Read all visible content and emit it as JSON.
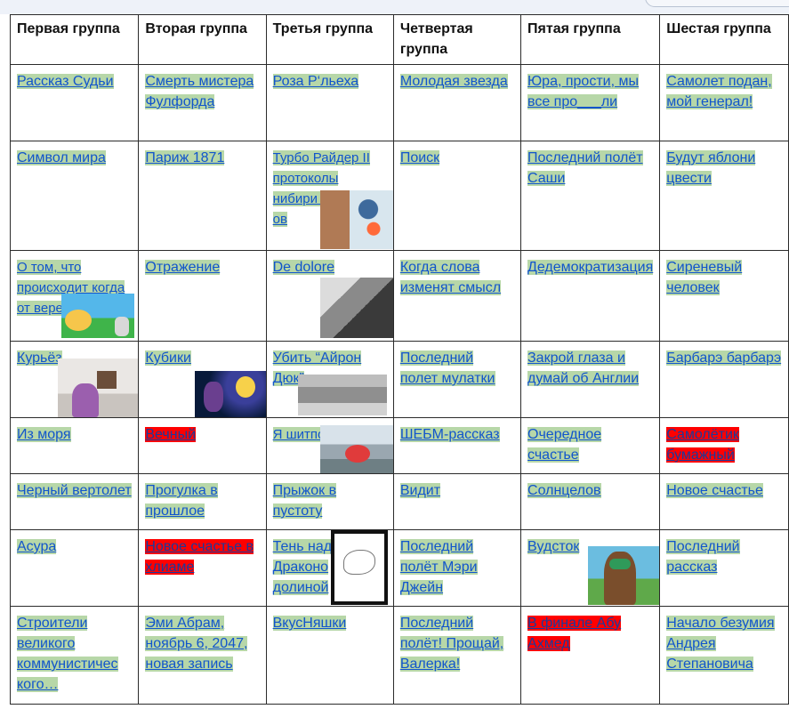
{
  "headers": [
    "Первая группа",
    "Вторая группа",
    "Третья группа",
    "Четвертая группа",
    "Пятая группа",
    "Шестая группа"
  ],
  "rows": [
    [
      "Рассказ Судьи",
      "Смерть мистера Фулфорда",
      "Роза Р‘льеха",
      "Молодая звезда",
      "Юра, прости, мы все про___ли",
      "Самолет подан, мой генерал!"
    ],
    [
      "Символ мира",
      "Париж 1871",
      "Турбо Райдер II протоколы нибири гаввахо ов",
      "Поиск",
      "Последний полёт Саши",
      "Будут яблони цвести"
    ],
    [
      "О том, что происходит когда от вереск",
      "Отражение",
      "De dolore",
      "Когда слова изменят смысл",
      "Дедемократизация",
      "Сиреневый человек"
    ],
    [
      "Курьёз",
      "Кубики",
      "Убить “Айрон Дюк”",
      "Последний полет мулатки",
      "Закрой глаза и думай об Англии",
      "Барбарэ барбарэ"
    ],
    [
      "Из моря",
      "Вечный",
      "Я шитпо сосаче",
      "ШЕБМ-рассказ",
      "Очередное счастье",
      "Самолётик бумажный"
    ],
    [
      "Черный вертолет",
      "Прогулка в прошлое",
      "Прыжок в пустоту",
      "Видит",
      "Солнцелов",
      "Новое счастье"
    ],
    [
      "Асура",
      "Новое счастье в хлиаме",
      "Тень над Драконо долиной",
      "Последний полёт Мэри Джейн",
      "Вудсток",
      "Последний рассказ"
    ],
    [
      "Строители великого коммунистичес кого…",
      "Эми Абрам, ноябрь 6, 2047, новая запись",
      "ВкусНяшки",
      "Последний полёт! Прощай, Валерка!",
      "В финале Абу Ахмед",
      "Начало безумия Андрея Степановича"
    ]
  ],
  "colors": {
    "highlight_green": "#b7d7a8",
    "highlight_red": "#ff0000",
    "link_blue": "#1155cc"
  }
}
